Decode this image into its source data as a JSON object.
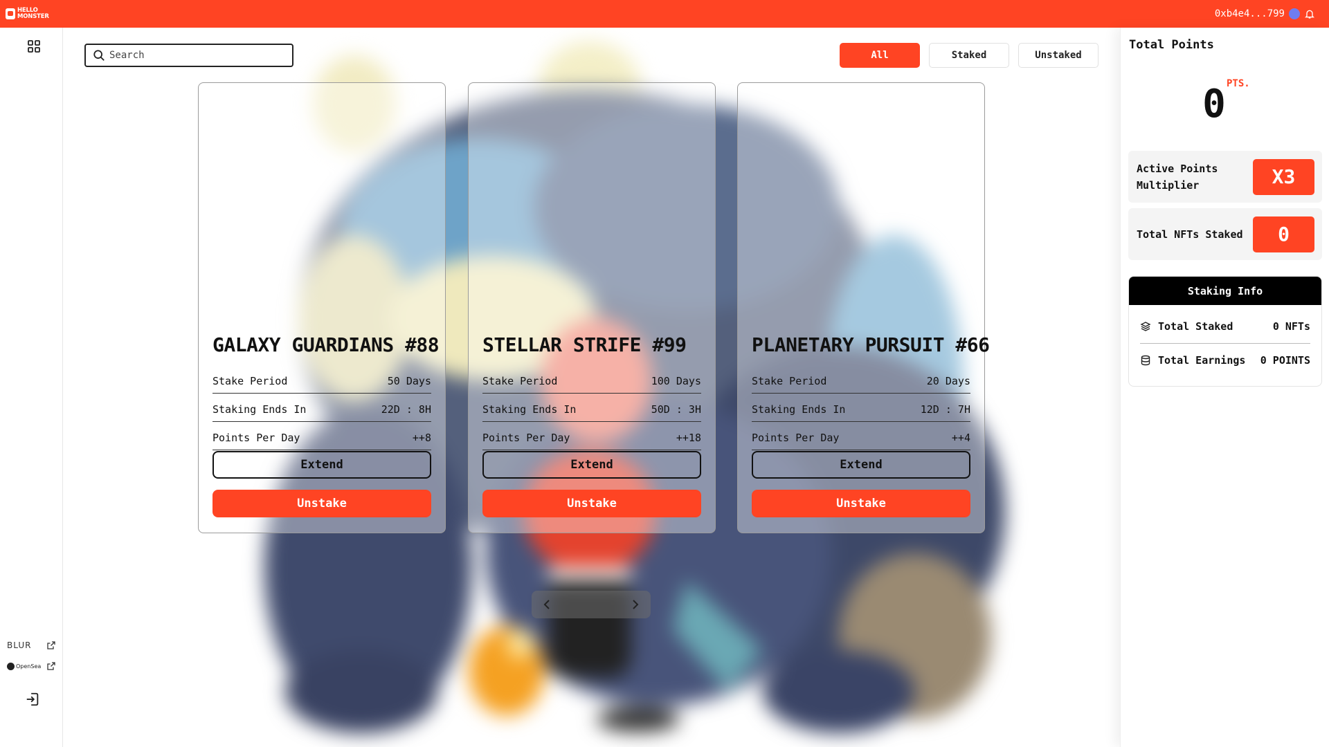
{
  "brand": {
    "line1": "HELLO",
    "line2": "MONSTER"
  },
  "wallet": {
    "address": "0xb4e4...799"
  },
  "colors": {
    "accent": "#ff4423",
    "dark": "#111111",
    "panel": "#f4f4f4"
  },
  "sidebar": {
    "dashboard_icon": "grid-icon",
    "markets": [
      {
        "label": "BLUR",
        "icon": "external-link-icon"
      },
      {
        "label": "OpenSea",
        "icon": "external-link-icon"
      }
    ],
    "logout_icon": "logout-icon"
  },
  "search": {
    "placeholder": "Search",
    "value": ""
  },
  "filters": [
    {
      "label": "All",
      "active": true
    },
    {
      "label": "Staked",
      "active": false
    },
    {
      "label": "Unstaked",
      "active": false
    }
  ],
  "cards": [
    {
      "title": "GALAXY GUARDIANS #88",
      "rows": [
        {
          "label": "Stake Period",
          "value": "50 Days"
        },
        {
          "label": "Staking Ends In",
          "value": "22D : 8H"
        },
        {
          "label": "Points Per Day",
          "value": "++8"
        }
      ],
      "extend_label": "Extend",
      "unstake_label": "Unstake"
    },
    {
      "title": "STELLAR STRIFE #99",
      "rows": [
        {
          "label": "Stake Period",
          "value": "100 Days"
        },
        {
          "label": "Staking Ends In",
          "value": "50D : 3H"
        },
        {
          "label": "Points Per Day",
          "value": "++18"
        }
      ],
      "extend_label": "Extend",
      "unstake_label": "Unstake"
    },
    {
      "title": "PLANETARY PURSUIT #66",
      "rows": [
        {
          "label": "Stake Period",
          "value": "20 Days"
        },
        {
          "label": "Staking Ends In",
          "value": "12D : 7H"
        },
        {
          "label": "Points Per Day",
          "value": "++4"
        }
      ],
      "extend_label": "Extend",
      "unstake_label": "Unstake"
    }
  ],
  "pager": {
    "prev_icon": "chevron-left-icon",
    "next_icon": "chevron-right-icon"
  },
  "points_panel": {
    "title": "Total Points",
    "value": "0",
    "unit": "PTS.",
    "multiplier": {
      "label": "Active Points Multiplier",
      "value": "X3"
    },
    "nfts_staked": {
      "label": "Total NFTs Staked",
      "value": "0"
    },
    "staking_info": {
      "title": "Staking Info",
      "rows": [
        {
          "label": "Total Staked",
          "value": "0 NFTs",
          "icon": "layers-icon"
        },
        {
          "label": "Total Earnings",
          "value": "0 POINTS",
          "icon": "database-icon"
        }
      ]
    }
  }
}
